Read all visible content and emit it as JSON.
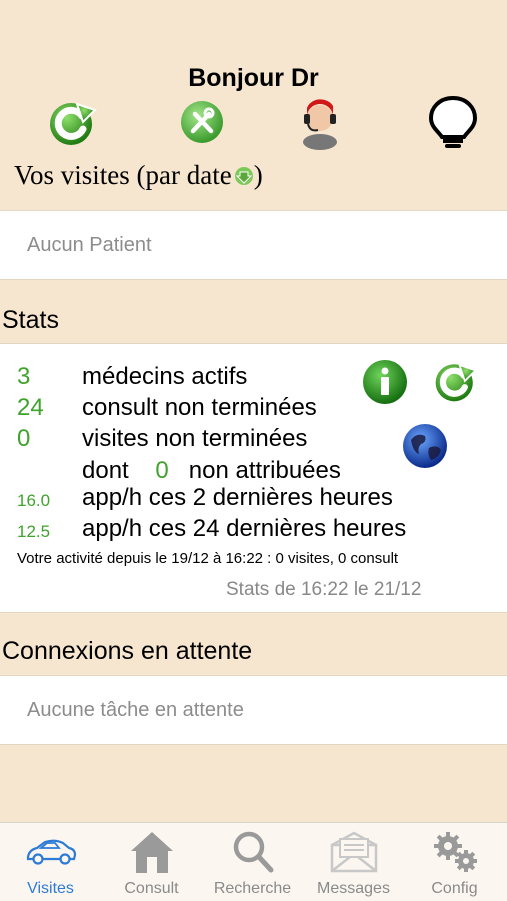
{
  "header": {
    "greeting": "Bonjour Dr",
    "icons": [
      "refresh-icon",
      "tools-icon",
      "operator-icon",
      "lightbulb-icon"
    ],
    "visits_title": "Vos visites (par date",
    "visits_title_close": ")"
  },
  "visits": {
    "empty": "Aucun Patient"
  },
  "stats": {
    "title": "Stats",
    "rows": [
      {
        "value": "3",
        "label": "médecins actifs"
      },
      {
        "value": "24",
        "label": "consult non terminées"
      },
      {
        "value": "0",
        "label": "visites non terminées"
      }
    ],
    "dont_prefix": "dont",
    "dont_value": "0",
    "dont_suffix": "non attribuées",
    "rates": [
      {
        "value": "16.0",
        "label": "app/h ces 2 dernières heures"
      },
      {
        "value": "12.5",
        "label": "app/h ces 24 dernières heures"
      }
    ],
    "activity": "Votre activité depuis le 19/12 à 16:22 : 0 visites, 0 consult",
    "timestamp": "Stats de  16:22 le 21/12"
  },
  "connexions": {
    "title": "Connexions en attente",
    "empty": "Aucune tâche en attente"
  },
  "tabbar": {
    "tabs": [
      {
        "label": "Visites",
        "icon": "car-icon"
      },
      {
        "label": "Consult",
        "icon": "house-icon"
      },
      {
        "label": "Recherche",
        "icon": "magnifier-icon"
      },
      {
        "label": "Messages",
        "icon": "envelope-icon"
      },
      {
        "label": "Config",
        "icon": "gears-icon"
      }
    ]
  },
  "colors": {
    "background": "#f6e6cf",
    "accent": "#2e7bd6",
    "stat_green": "#3fa32c"
  }
}
